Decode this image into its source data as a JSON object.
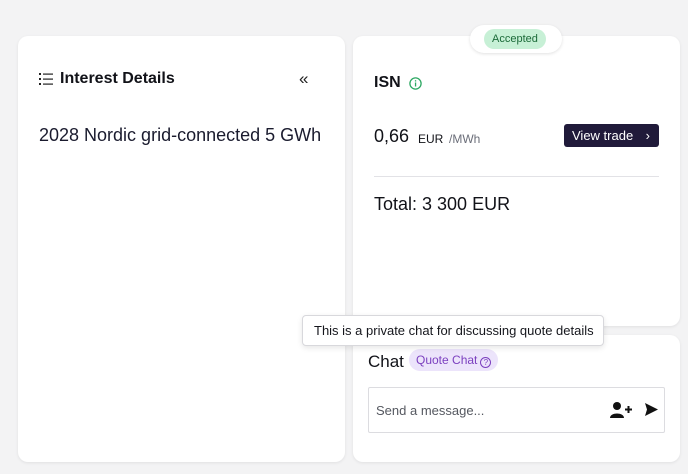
{
  "interest_panel": {
    "title": "Interest Details",
    "collapse_glyph": "«",
    "interest_name": "2028 Nordic grid-connected 5 GWh",
    "icons": {
      "header": "list-icon",
      "collapse": "double-chevron-left-icon"
    }
  },
  "quote": {
    "status_badge": "Accepted",
    "code": "ISN",
    "price_value": "0,66",
    "price_currency": "EUR",
    "price_unit": "/MWh",
    "view_trade_label": "View trade",
    "total": "Total: 3 300 EUR",
    "colors": {
      "badge_bg": "#c7f0d6",
      "badge_text": "#1c6b39",
      "button_bg": "#201a3a",
      "info_icon": "#2ea863"
    }
  },
  "chat": {
    "tooltip": "This is a private chat for discussing quote details",
    "title": "Chat",
    "chip_label": "Quote Chat",
    "input_placeholder": "Send a message...",
    "icons": {
      "add_user": "add-user-icon",
      "send": "send-icon",
      "help": "question-circle-icon"
    },
    "colors": {
      "chip_bg": "#ece4fb",
      "chip_text": "#7b3fbf"
    }
  }
}
